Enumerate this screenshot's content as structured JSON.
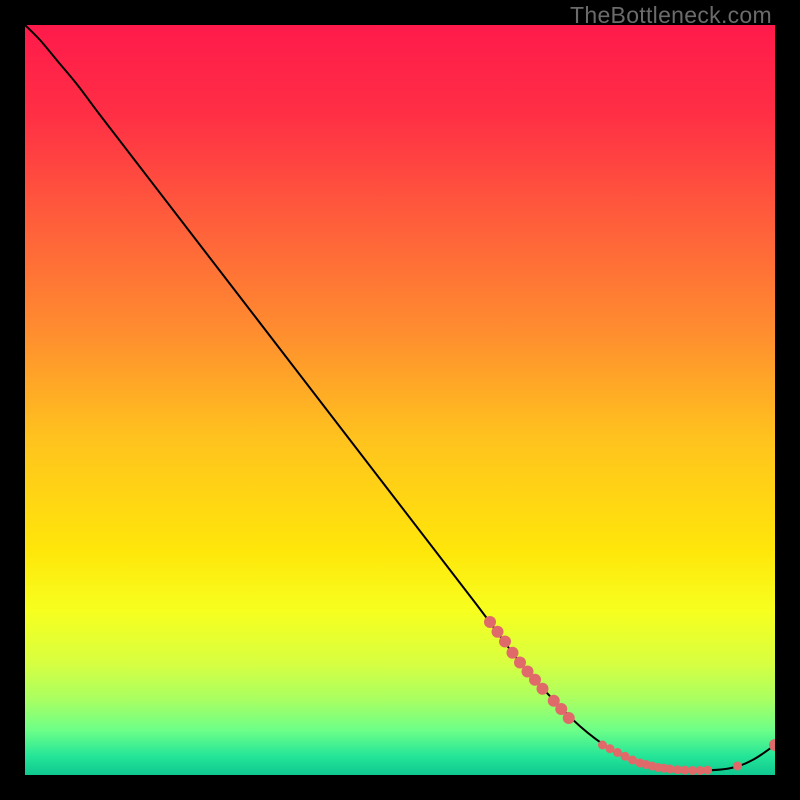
{
  "watermark": "TheBottleneck.com",
  "chart_data": {
    "type": "line",
    "title": "",
    "xlabel": "",
    "ylabel": "",
    "xlim": [
      0,
      100
    ],
    "ylim": [
      0,
      100
    ],
    "grid": false,
    "legend": false,
    "background_gradient": {
      "type": "vertical",
      "stops": [
        {
          "offset": 0.0,
          "color": "#ff1a4b"
        },
        {
          "offset": 0.12,
          "color": "#ff2f45"
        },
        {
          "offset": 0.25,
          "color": "#ff5a3c"
        },
        {
          "offset": 0.4,
          "color": "#ff8a30"
        },
        {
          "offset": 0.55,
          "color": "#ffc21e"
        },
        {
          "offset": 0.7,
          "color": "#ffe60a"
        },
        {
          "offset": 0.78,
          "color": "#f7ff1e"
        },
        {
          "offset": 0.85,
          "color": "#d8ff40"
        },
        {
          "offset": 0.9,
          "color": "#a8ff62"
        },
        {
          "offset": 0.94,
          "color": "#6dff88"
        },
        {
          "offset": 0.975,
          "color": "#24e598"
        },
        {
          "offset": 1.0,
          "color": "#0fc890"
        }
      ]
    },
    "series": [
      {
        "name": "bottleneck-curve",
        "color": "#000000",
        "x": [
          0.0,
          2.0,
          4.5,
          7.0,
          10.0,
          15.0,
          20.0,
          30.0,
          40.0,
          50.0,
          60.0,
          66.0,
          70.0,
          74.0,
          78.0,
          82.0,
          86.0,
          90.0,
          94.0,
          97.0,
          100.0
        ],
        "y": [
          100.0,
          98.0,
          95.0,
          92.0,
          88.0,
          81.5,
          75.0,
          62.0,
          49.0,
          36.0,
          23.0,
          15.0,
          10.5,
          6.5,
          3.5,
          1.6,
          0.8,
          0.6,
          0.9,
          2.0,
          4.0
        ]
      }
    ],
    "markers": {
      "name": "highlight-dots",
      "color": "#e06a6a",
      "radius_big": 6,
      "radius_small": 4.5,
      "points": [
        {
          "x": 62.0,
          "y": 20.4,
          "r": "big"
        },
        {
          "x": 63.0,
          "y": 19.1,
          "r": "big"
        },
        {
          "x": 64.0,
          "y": 17.8,
          "r": "big"
        },
        {
          "x": 65.0,
          "y": 16.3,
          "r": "big"
        },
        {
          "x": 66.0,
          "y": 15.0,
          "r": "big"
        },
        {
          "x": 67.0,
          "y": 13.8,
          "r": "big"
        },
        {
          "x": 68.0,
          "y": 12.7,
          "r": "big"
        },
        {
          "x": 69.0,
          "y": 11.5,
          "r": "big"
        },
        {
          "x": 70.5,
          "y": 9.9,
          "r": "big"
        },
        {
          "x": 71.5,
          "y": 8.8,
          "r": "big"
        },
        {
          "x": 72.5,
          "y": 7.6,
          "r": "big"
        },
        {
          "x": 77.0,
          "y": 4.0,
          "r": "small"
        },
        {
          "x": 78.0,
          "y": 3.5,
          "r": "small"
        },
        {
          "x": 79.0,
          "y": 3.0,
          "r": "small"
        },
        {
          "x": 80.0,
          "y": 2.5,
          "r": "small"
        },
        {
          "x": 81.0,
          "y": 2.0,
          "r": "small"
        },
        {
          "x": 82.0,
          "y": 1.6,
          "r": "small"
        },
        {
          "x": 82.8,
          "y": 1.4,
          "r": "small"
        },
        {
          "x": 83.6,
          "y": 1.2,
          "r": "small"
        },
        {
          "x": 84.4,
          "y": 1.0,
          "r": "small"
        },
        {
          "x": 85.2,
          "y": 0.9,
          "r": "small"
        },
        {
          "x": 86.0,
          "y": 0.8,
          "r": "small"
        },
        {
          "x": 87.0,
          "y": 0.7,
          "r": "small"
        },
        {
          "x": 88.0,
          "y": 0.65,
          "r": "small"
        },
        {
          "x": 89.0,
          "y": 0.6,
          "r": "small"
        },
        {
          "x": 90.0,
          "y": 0.6,
          "r": "small"
        },
        {
          "x": 91.0,
          "y": 0.65,
          "r": "small"
        },
        {
          "x": 95.0,
          "y": 1.2,
          "r": "small"
        },
        {
          "x": 100.0,
          "y": 4.0,
          "r": "big"
        }
      ]
    }
  }
}
